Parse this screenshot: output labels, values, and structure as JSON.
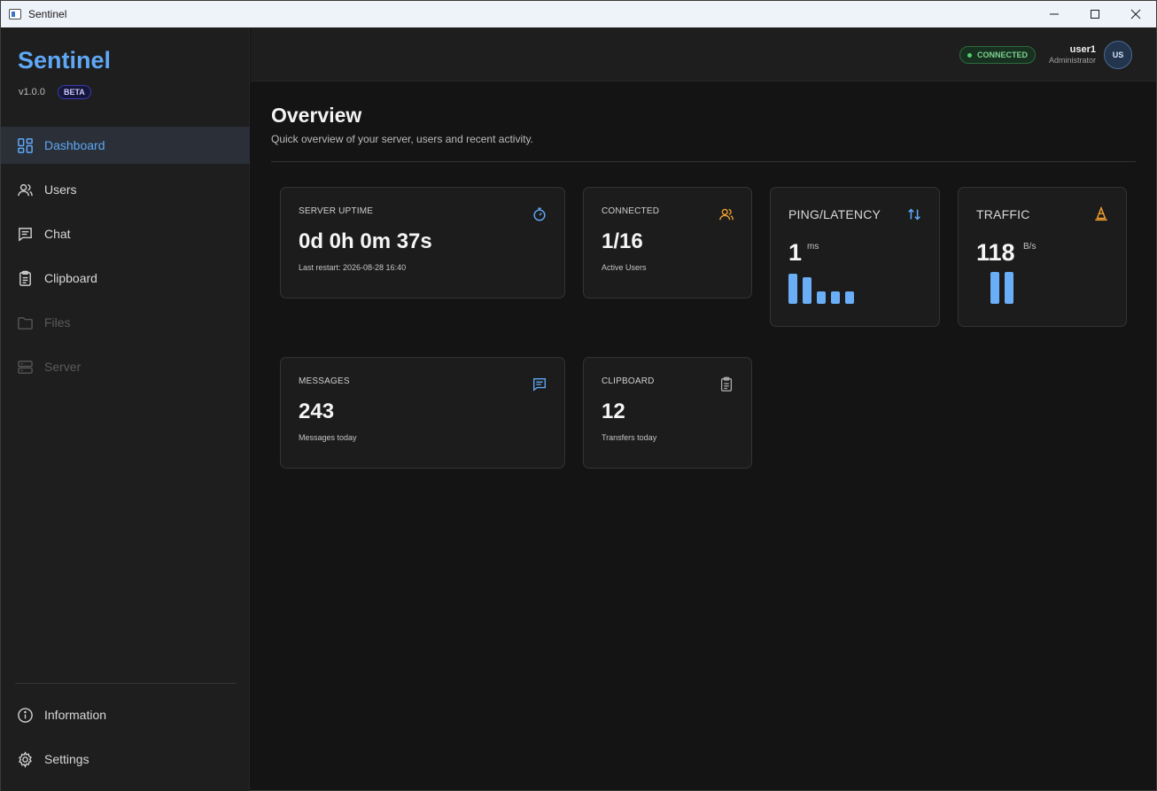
{
  "window": {
    "title": "Sentinel"
  },
  "sidebar": {
    "brand": "Sentinel",
    "version": "v1.0.0",
    "badge": "BETA",
    "items": [
      {
        "label": "Dashboard",
        "icon": "dashboard-icon",
        "active": true
      },
      {
        "label": "Users",
        "icon": "users-icon"
      },
      {
        "label": "Chat",
        "icon": "chat-icon"
      },
      {
        "label": "Clipboard",
        "icon": "clipboard-icon"
      },
      {
        "label": "Files",
        "icon": "folder-icon",
        "disabled": true
      },
      {
        "label": "Server",
        "icon": "server-icon",
        "disabled": true
      }
    ],
    "bottom_items": [
      {
        "label": "Information",
        "icon": "info-icon"
      },
      {
        "label": "Settings",
        "icon": "gear-icon"
      }
    ]
  },
  "header": {
    "status": "CONNECTED",
    "user_name": "user1",
    "user_role": "Administrator",
    "avatar_initials": "US"
  },
  "main": {
    "title": "Overview",
    "subtitle": "Quick overview of your server, users and recent activity."
  },
  "cards": {
    "uptime": {
      "label": "SERVER UPTIME",
      "value": "0d 0h 0m 37s",
      "sub": "Last restart: 2026-08-28 16:40",
      "icon": "stopwatch-icon"
    },
    "connected": {
      "label": "CONNECTED",
      "value": "1/16",
      "sub": "Active Users",
      "icon": "users-icon"
    },
    "ping": {
      "label": "PING/LATENCY",
      "value": "1",
      "unit": "ms",
      "icon": "up-down-arrows-icon",
      "bars": [
        1.0,
        0.88,
        0.42,
        0.42,
        0.42
      ]
    },
    "traffic": {
      "label": "TRAFFIC",
      "value": "118",
      "unit": "B/s",
      "icon": "cone-icon",
      "bars": [
        1.0,
        1.0
      ]
    },
    "messages": {
      "label": "MESSAGES",
      "value": "243",
      "sub": "Messages today",
      "icon": "message-icon"
    },
    "clipboard": {
      "label": "CLIPBOARD",
      "value": "12",
      "sub": "Transfers today",
      "icon": "clipboard-icon"
    }
  },
  "colors": {
    "accent": "#5fa8f5",
    "orange": "#f0a030",
    "connected_green": "#4fcf6b"
  }
}
